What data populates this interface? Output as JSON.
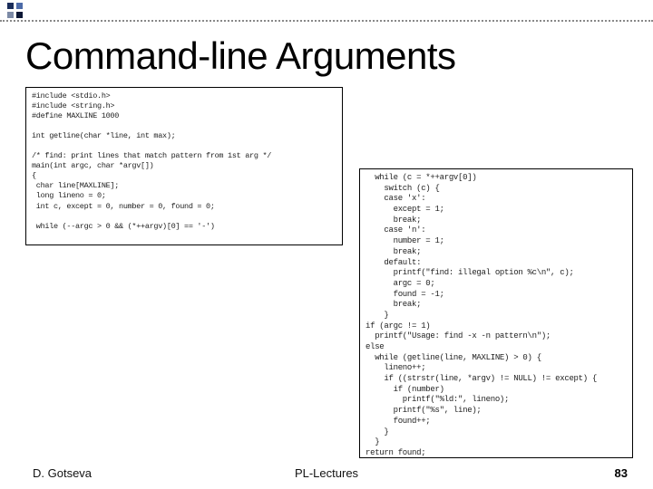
{
  "title": "Command-line Arguments",
  "code_left": "#include <stdio.h>\n#include <string.h>\n#define MAXLINE 1000\n\nint getline(char *line, int max);\n\n/* find: print lines that match pattern from 1st arg */\nmain(int argc, char *argv[])\n{\n char line[MAXLINE];\n long lineno = 0;\n int c, except = 0, number = 0, found = 0;\n\n while (--argc > 0 && (*++argv)[0] == '-')",
  "code_right": "  while (c = *++argv[0])\n    switch (c) {\n    case 'x':\n      except = 1;\n      break;\n    case 'n':\n      number = 1;\n      break;\n    default:\n      printf(\"find: illegal option %c\\n\", c);\n      argc = 0;\n      found = -1;\n      break;\n    }\nif (argc != 1)\n  printf(\"Usage: find -x -n pattern\\n\");\nelse\n  while (getline(line, MAXLINE) > 0) {\n    lineno++;\n    if ((strstr(line, *argv) != NULL) != except) {\n      if (number)\n        printf(\"%ld:\", lineno);\n      printf(\"%s\", line);\n      found++;\n    }\n  }\nreturn found;\n}",
  "footer": {
    "author": "D. Gotseva",
    "center": "PL-Lectures",
    "page": "83"
  }
}
